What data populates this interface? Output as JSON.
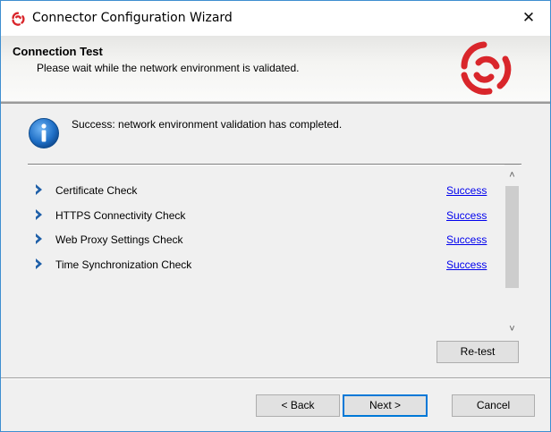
{
  "window": {
    "title": "Connector Configuration Wizard",
    "close_glyph": "✕",
    "brand_color": "#d9262b"
  },
  "header": {
    "title": "Connection Test",
    "subtitle": "Please wait while the network environment is validated."
  },
  "status": {
    "icon": "info-icon",
    "message": "Success: network environment validation has completed."
  },
  "checks": [
    {
      "label": "Certificate Check",
      "result": "Success"
    },
    {
      "label": "HTTPS Connectivity Check",
      "result": "Success"
    },
    {
      "label": "Web Proxy Settings Check",
      "result": "Success"
    },
    {
      "label": "Time Synchronization Check",
      "result": "Success"
    }
  ],
  "buttons": {
    "retest": "Re-test",
    "back": "< Back",
    "next": "Next >",
    "cancel": "Cancel"
  },
  "scrollbar": {
    "up_glyph": "˄",
    "down_glyph": "˅"
  }
}
